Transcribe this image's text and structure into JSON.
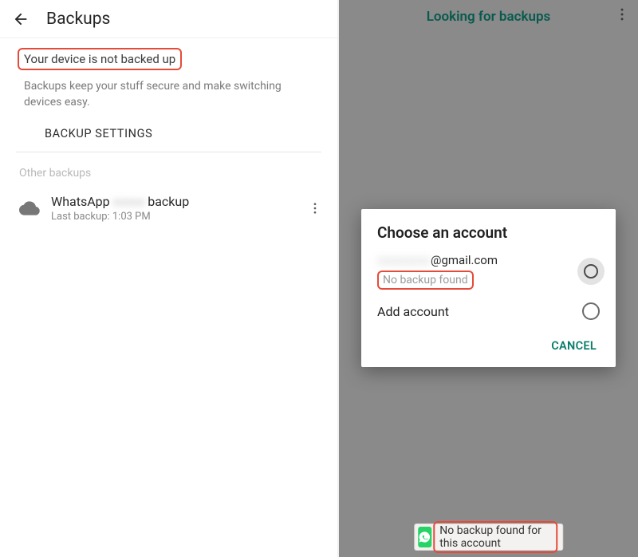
{
  "left": {
    "title": "Backups",
    "alert": "Your device is not backed up",
    "desc": "Backups keep your stuff secure and make switching devices easy.",
    "settings": "BACKUP SETTINGS",
    "other": "Other backups",
    "row": {
      "app": "WhatsApp",
      "masked": "xxxxx",
      "suffix": "backup",
      "sub": "Last backup: 1:03 PM"
    }
  },
  "right": {
    "title": "Looking for backups",
    "dialog": {
      "title": "Choose an account",
      "email_masked": "xxxxxxxxx",
      "email_domain": "@gmail.com",
      "status": "No backup found",
      "add": "Add account",
      "cancel": "CANCEL"
    },
    "toast": "No backup found for this account"
  }
}
